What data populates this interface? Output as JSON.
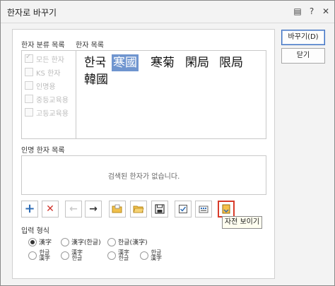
{
  "window": {
    "title": "한자로 바꾸기",
    "titlebar_icons": [
      "list-icon",
      "help-icon",
      "close-icon"
    ],
    "titlebar_glyphs": {
      "menu": "▤",
      "help": "?",
      "close": "✕"
    }
  },
  "categories": {
    "label": "한자 분류 목록",
    "items": [
      {
        "label": "모든 한자",
        "checked": true
      },
      {
        "label": "KS 한자",
        "checked": false
      },
      {
        "label": "인명용",
        "checked": false
      },
      {
        "label": "중등교육용",
        "checked": false
      },
      {
        "label": "고등교육용",
        "checked": false
      }
    ]
  },
  "hanja_list": {
    "label": "한자 목록",
    "items": [
      {
        "text": "한국",
        "selected": false
      },
      {
        "text": "寒國",
        "selected": true
      },
      {
        "text": "寒菊",
        "selected": false
      },
      {
        "text": "閑局",
        "selected": false
      },
      {
        "text": "限局",
        "selected": false
      },
      {
        "text": "韓國",
        "selected": false
      }
    ]
  },
  "person_hanja": {
    "label": "인명 한자 목록",
    "empty_message": "검색된 한자가 없습니다."
  },
  "toolbar": {
    "buttons": [
      "add",
      "delete",
      "back",
      "forward",
      "open-folder",
      "folder",
      "save",
      "checklist",
      "properties",
      "dictionary-view"
    ],
    "add_glyph": "+",
    "delete_glyph": "✕",
    "back_glyph": "←",
    "forward_glyph": "→",
    "tooltip": "자전 보이기"
  },
  "input_format": {
    "label": "입력 형식",
    "options_row1": [
      {
        "label": "漢字",
        "selected": true
      },
      {
        "label": "漢字(한글)",
        "selected": false
      },
      {
        "label": "한글(漢字)",
        "selected": false
      }
    ],
    "options_row2": [
      {
        "top": "한글",
        "bottom": "漢字"
      },
      {
        "top": "漢字",
        "bottom": "한글"
      },
      {
        "top": "漢字",
        "bottom": "한글"
      },
      {
        "top": "한글",
        "bottom": "漢字"
      }
    ]
  },
  "actions": {
    "convert_label": "바꾸기(D)",
    "close_label": "닫기"
  },
  "colors": {
    "accent": "#3c6fc0",
    "selection": "#6f95cf",
    "plus_blue": "#2f6db5",
    "delete_red": "#d0342c",
    "highlight_red": "#d83b2a"
  }
}
